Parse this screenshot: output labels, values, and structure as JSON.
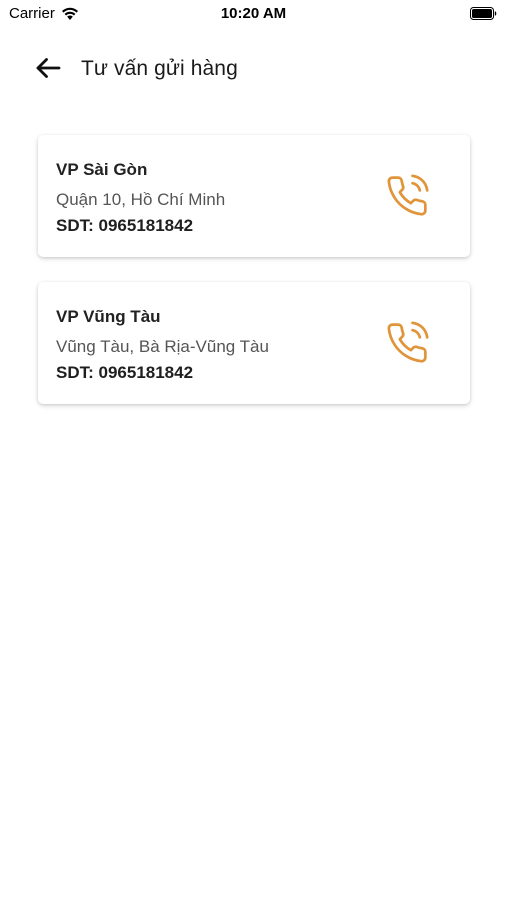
{
  "status_bar": {
    "carrier": "Carrier",
    "time": "10:20 AM",
    "wifi_icon": "wifi-icon",
    "battery_icon": "battery-icon"
  },
  "header": {
    "back_icon": "arrow-left-icon",
    "title": "Tư vấn gửi hàng"
  },
  "colors": {
    "accent": "#E0953A",
    "text_primary": "#1f1f1f",
    "text_secondary": "#555555"
  },
  "offices": [
    {
      "name": "VP Sài Gòn",
      "address": "Quận 10, Hồ Chí Minh",
      "phone": "SDT: 0965181842",
      "call_icon": "phone-call-icon"
    },
    {
      "name": "VP Vũng Tàu",
      "address": "Vũng Tàu, Bà Rịa-Vũng Tàu",
      "phone": "SDT: 0965181842",
      "call_icon": "phone-call-icon"
    }
  ]
}
